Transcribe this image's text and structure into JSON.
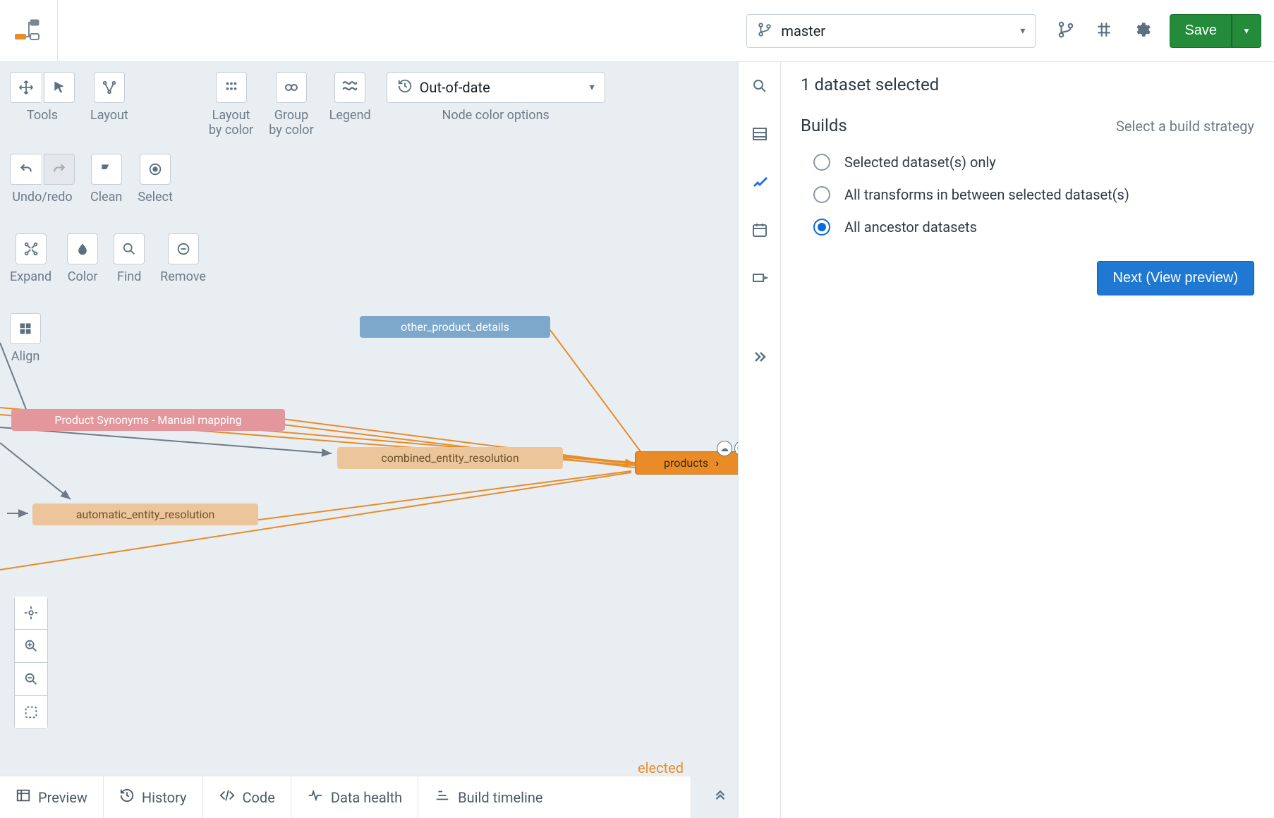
{
  "branch": {
    "name": "master"
  },
  "topActions": {
    "save": "Save"
  },
  "toolbar": {
    "tools": "Tools",
    "layout": "Layout",
    "layout_by_color": "Layout\nby color",
    "group_by_color": "Group\nby color",
    "legend": "Legend",
    "node_color_options": "Node color options",
    "node_color_select": "Out-of-date",
    "undo_redo": "Undo/redo",
    "clean": "Clean",
    "select": "Select",
    "expand": "Expand",
    "color": "Color",
    "find": "Find",
    "remove": "Remove",
    "align": "Align"
  },
  "nodes": {
    "other_product_details": "other_product_details",
    "product_synonyms": "Product Synonyms - Manual mapping",
    "combined_entity_resolution": "combined_entity_resolution",
    "automatic_entity_resolution": "automatic_entity_resolution",
    "products": "products"
  },
  "bottomTabs": {
    "preview": "Preview",
    "history": "History",
    "code": "Code",
    "data_health": "Data health",
    "build_timeline": "Build timeline",
    "selected_hint": "elected"
  },
  "rightPanel": {
    "title": "1 dataset selected",
    "builds": "Builds",
    "strategy_hint": "Select a build strategy",
    "options": {
      "selected_only": "Selected dataset(s) only",
      "all_transforms": "All transforms in between selected dataset(s)",
      "all_ancestors": "All ancestor datasets"
    },
    "next": "Next (View preview)"
  }
}
